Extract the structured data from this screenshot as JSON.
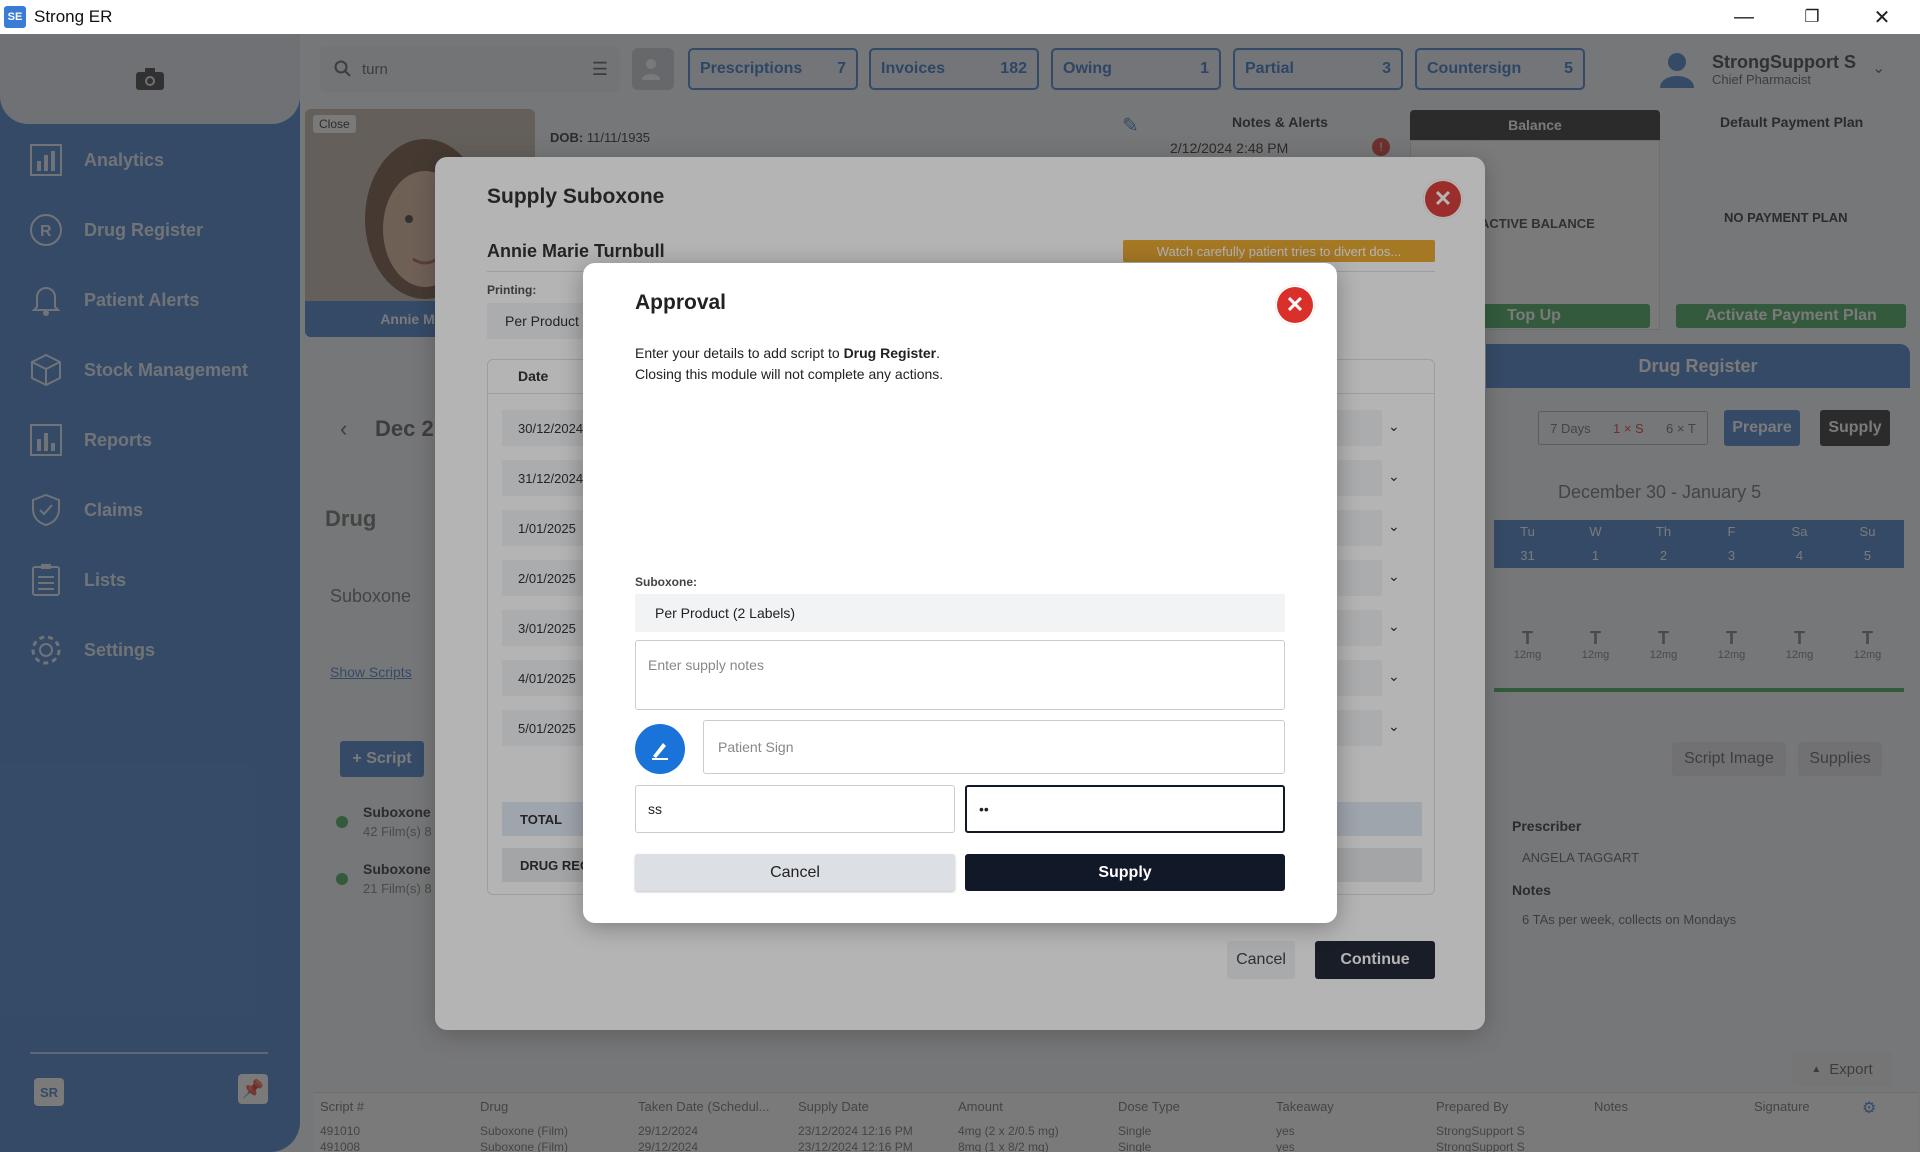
{
  "window": {
    "title": "Strong ER",
    "logo_text": "SE",
    "minimize": "—",
    "maximize": "❐",
    "close": "✕"
  },
  "sidebar": {
    "items": [
      {
        "label": "Analytics",
        "icon": "analytics-icon"
      },
      {
        "label": "Drug Register",
        "icon": "rx-icon"
      },
      {
        "label": "Patient Alerts",
        "icon": "bell-icon"
      },
      {
        "label": "Stock Management",
        "icon": "box-icon"
      },
      {
        "label": "Reports",
        "icon": "bar-chart-icon"
      },
      {
        "label": "Claims",
        "icon": "shield-check-icon"
      },
      {
        "label": "Lists",
        "icon": "list-icon"
      },
      {
        "label": "Settings",
        "icon": "gear-icon"
      }
    ],
    "footer_logo": "SR"
  },
  "topbar": {
    "search_value": "turn",
    "pills": [
      {
        "label": "Prescriptions",
        "count": "7"
      },
      {
        "label": "Invoices",
        "count": "182"
      },
      {
        "label": "Owing",
        "count": "1"
      },
      {
        "label": "Partial",
        "count": "3"
      },
      {
        "label": "Countersign",
        "count": "5"
      }
    ],
    "user_name": "StrongSupport S",
    "user_role": "Chief Pharmacist"
  },
  "patient": {
    "close_label": "Close",
    "name_short": "Annie Marie",
    "dob_label": "DOB:",
    "dob": "11/11/1935",
    "notes_title": "Notes & Alerts",
    "notes_date": "2/12/2024 2:48 PM",
    "balance_title": "Balance",
    "balance_text": "ACTIVE BALANCE",
    "top_up": "Top Up",
    "payment_title": "Default Payment Plan",
    "payment_text": "NO PAYMENT PLAN",
    "activate_plan": "Activate Payment Plan"
  },
  "background": {
    "month_label": "Dec 2",
    "drug_heading": "Drug",
    "drug_name": "Suboxone",
    "show_scripts": "Show Scripts",
    "add_script": "+ Script",
    "script_items": [
      {
        "name": "Suboxone",
        "detail": "42 Film(s) 8"
      },
      {
        "name": "Suboxone",
        "detail": "21 Film(s) 8"
      }
    ],
    "drug_register_title": "Drug Register",
    "filters": [
      "7 Days",
      "1 × S",
      "6 × T"
    ],
    "prepare": "Prepare",
    "supply": "Supply",
    "calendar_range": "December 30 - January 5",
    "weekdays": [
      "Tu",
      "W",
      "Th",
      "F",
      "Sa",
      "Su"
    ],
    "daynums": [
      "31",
      "1",
      "2",
      "3",
      "4",
      "5"
    ],
    "dose_letter": "T",
    "dose_amount": "12mg",
    "script_image": "Script Image",
    "supplies": "Supplies",
    "prescriber_label": "Prescriber",
    "prescriber": "ANGELA TAGGART",
    "notes_label": "Notes",
    "notes_text": "6 TAs per week, collects on Mondays",
    "export": "Export",
    "table_headers": [
      "Script #",
      "Drug",
      "Taken Date (Schedul...",
      "Supply Date",
      "Amount",
      "Dose Type",
      "Takeaway",
      "Prepared By",
      "Notes",
      "Signature"
    ],
    "table_rows": [
      [
        "491010",
        "Suboxone (Film)",
        "29/12/2024",
        "23/12/2024 12:16 PM",
        "4mg (2 x 2/0.5 mg)",
        "Single",
        "yes",
        "StrongSupport S",
        "",
        ""
      ],
      [
        "491008",
        "Suboxone (Film)",
        "29/12/2024",
        "23/12/2024 12:16 PM",
        "8mg (1 x 8/2 mg)",
        "Single",
        "yes",
        "StrongSupport S",
        "",
        ""
      ]
    ]
  },
  "supply_modal": {
    "title": "Supply Suboxone",
    "patient_name": "Annie Marie Turnbull",
    "alert_banner": "Watch carefully patient tries to divert dos...",
    "printing_label": "Printing:",
    "printing_value": "Per Product",
    "date_header": "Date",
    "dates": [
      "30/12/2024",
      "31/12/2024",
      "1/01/2025",
      "2/01/2025",
      "3/01/2025",
      "4/01/2025",
      "5/01/2025"
    ],
    "total_label": "TOTAL",
    "drug_reg_label": "DRUG REG",
    "cancel": "Cancel",
    "continue": "Continue"
  },
  "approval": {
    "title": "Approval",
    "desc_prefix": "Enter your details to add script to ",
    "desc_bold": "Drug Register",
    "desc_suffix": ".",
    "desc_line2": "Closing this module will not complete any actions.",
    "suboxone_label": "Suboxone:",
    "print_option": "Per Product (2 Labels)",
    "notes_placeholder": "Enter supply notes",
    "sign_placeholder": "Patient Sign",
    "username_value": "ss",
    "password_value": "••",
    "cancel": "Cancel",
    "supply": "Supply"
  },
  "colors": {
    "primary_blue": "#3d79c9",
    "danger_red": "#d9302c",
    "alert_orange": "#e8a322",
    "green": "#3aa655",
    "dark_button": "#111827"
  }
}
